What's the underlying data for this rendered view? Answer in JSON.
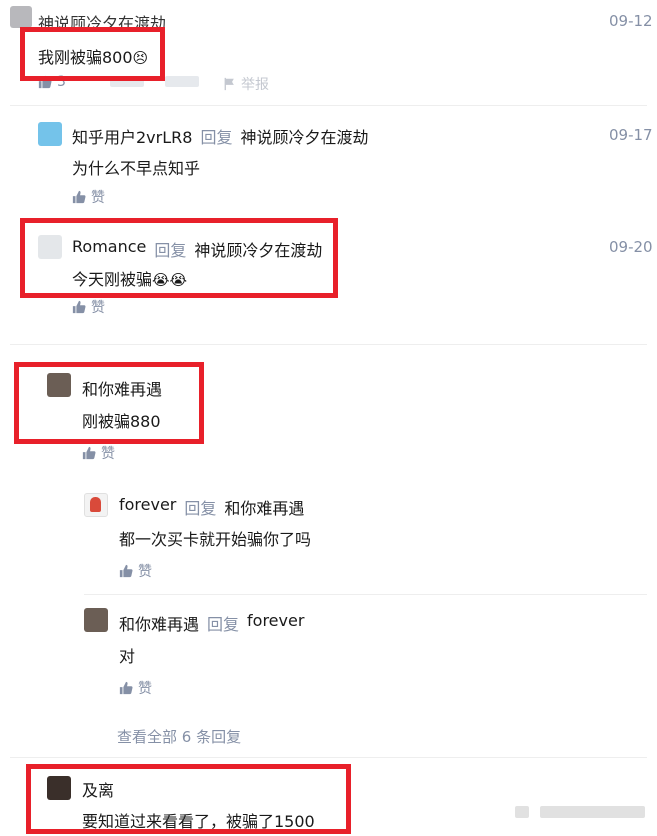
{
  "comments": [
    {
      "author": "神说顾冷夕在渡劫",
      "date": "09-12",
      "text": "我刚被骗800",
      "emoji": "😣",
      "likes": "3",
      "actions": [
        "",
        "",
        "举报"
      ]
    },
    {
      "author": "知乎用户2vrLR8",
      "reply_label": "回复",
      "reply_to": "神说顾冷夕在渡劫",
      "date": "09-17",
      "text": "为什么不早点知乎",
      "like_label": "赞"
    },
    {
      "author": "Romance",
      "reply_label": "回复",
      "reply_to": "神说顾冷夕在渡劫",
      "date": "09-20",
      "text": "今天刚被骗",
      "emoji": "😭😭",
      "like_label": "赞"
    },
    {
      "author": "和你难再遇",
      "text": "刚被骗880",
      "like_label": "赞"
    },
    {
      "author": "forever",
      "reply_label": "回复",
      "reply_to": "和你难再遇",
      "text": "都一次买卡就开始骗你了吗",
      "like_label": "赞"
    },
    {
      "author": "和你难再遇",
      "reply_label": "回复",
      "reply_to": "forever",
      "text": "对",
      "like_label": "赞"
    },
    {
      "author": "及离",
      "text": "要知道过来看看了，被骗了1500"
    }
  ],
  "view_all_replies": "查看全部 6 条回复",
  "colors": {
    "highlight": "#e8202a",
    "meta": "#8590a6",
    "text": "#1a1a1a"
  }
}
